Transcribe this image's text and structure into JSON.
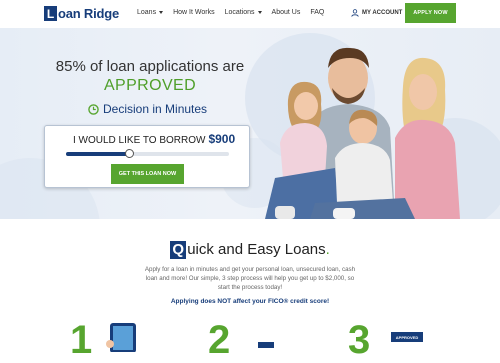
{
  "brand": {
    "logo_letter": "L",
    "logo_rest": "oan Ridge",
    "primary_color": "#173d7a",
    "accent_color": "#57a52f"
  },
  "nav": {
    "items": [
      {
        "label": "Loans",
        "has_dropdown": true
      },
      {
        "label": "How It Works",
        "has_dropdown": false
      },
      {
        "label": "Locations",
        "has_dropdown": true
      },
      {
        "label": "About Us",
        "has_dropdown": false
      },
      {
        "label": "FAQ",
        "has_dropdown": false
      }
    ],
    "account_label": "MY ACCOUNT",
    "apply_label": "APPLY NOW"
  },
  "hero": {
    "headline": "85% of loan applications are",
    "approved": "APPROVED",
    "decision": "Decision in Minutes",
    "borrow_label": "I WOULD LIKE TO BORROW",
    "borrow_amount": "$900",
    "slider_fraction": 0.39,
    "cta_label": "GET THIS LOAN NOW"
  },
  "section": {
    "title_first_letter": "Q",
    "title_rest": "uick and Easy Loans",
    "title_dot": ".",
    "description": "Apply for a loan in minutes and get your personal loan, unsecured loan, cash loan and more! Our simple, 3 step process will help you get up to $2,000, so start the process today!",
    "fico_note": "Applying does NOT affect your FICO® credit score!",
    "steps": [
      "1",
      "2",
      "3"
    ],
    "approved_badge": "APPROVED"
  }
}
